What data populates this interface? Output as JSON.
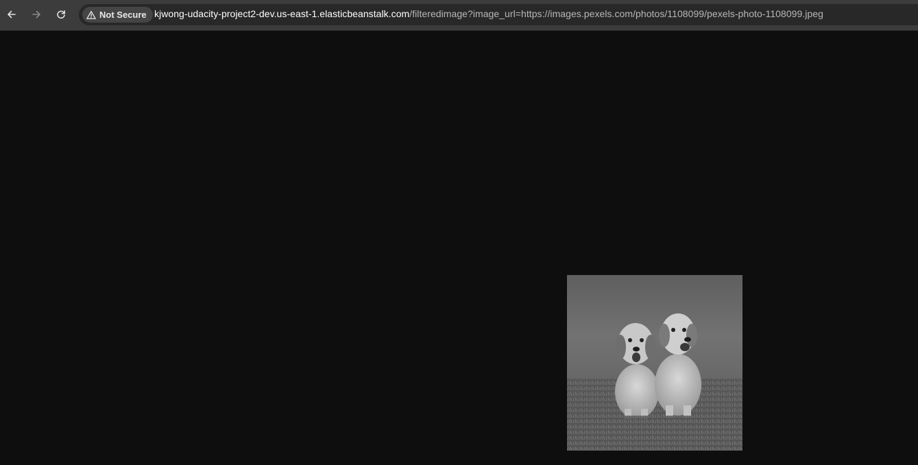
{
  "toolbar": {
    "back_icon": "arrow-left-icon",
    "forward_icon": "arrow-right-icon",
    "reload_icon": "reload-icon",
    "security": {
      "icon": "warning-triangle-icon",
      "label": "Not Secure"
    },
    "url": {
      "host": "kjwong-udacity-project2-dev.us-east-1.elasticbeanstalk.com",
      "path": "/filteredimage?image_url=https://images.pexels.com/photos/1108099/pexels-photo-1108099.jpeg"
    }
  },
  "page": {
    "background": "#0e0e0e",
    "image": {
      "description_icon": "grayscale-puppies-photo",
      "filter": "grayscale"
    }
  }
}
